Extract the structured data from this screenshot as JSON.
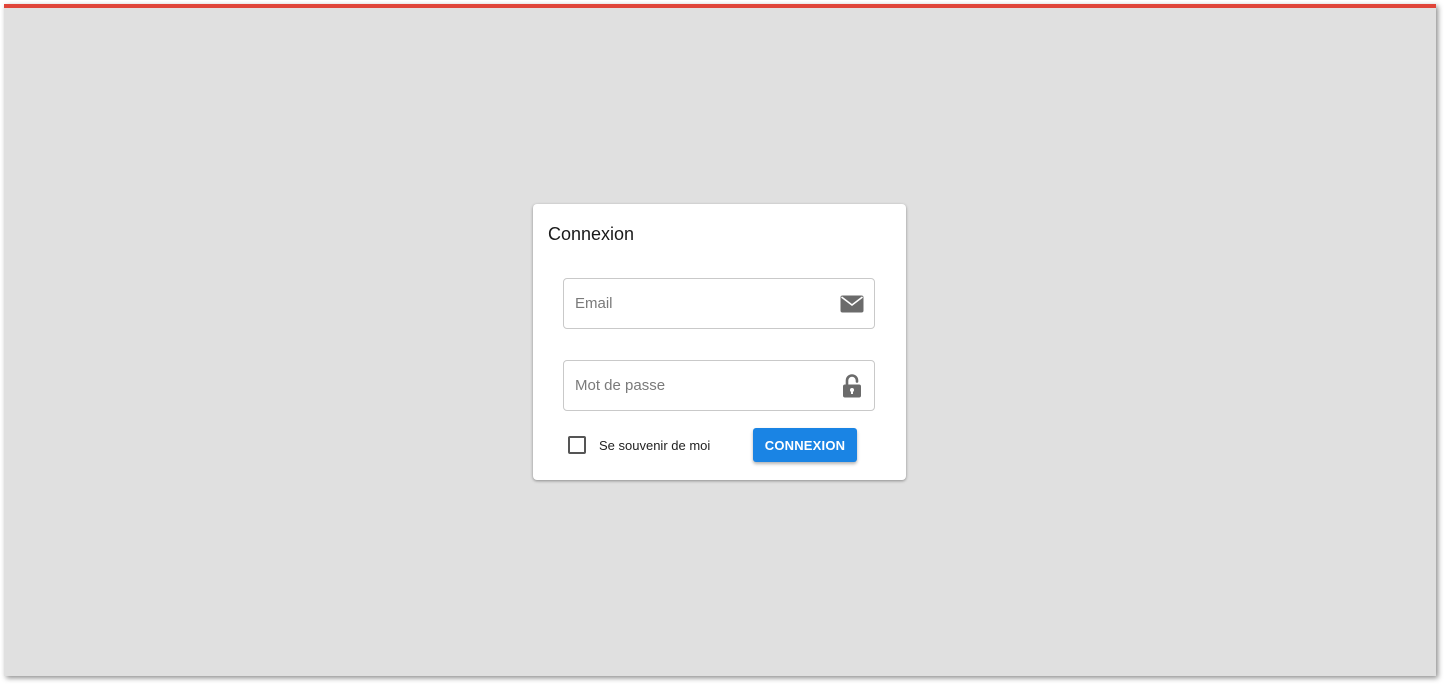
{
  "colors": {
    "top_bar": "#e0453a",
    "background": "#e0e0e0",
    "card": "#ffffff",
    "primary_button": "#1a84e4"
  },
  "login_form": {
    "title": "Connexion",
    "email": {
      "placeholder": "Email",
      "value": "",
      "icon": "envelope-icon"
    },
    "password": {
      "placeholder": "Mot de passe",
      "value": "",
      "icon": "unlock-icon"
    },
    "remember_me": {
      "label": "Se souvenir de moi",
      "checked": false
    },
    "submit_label": "CONNEXION"
  }
}
